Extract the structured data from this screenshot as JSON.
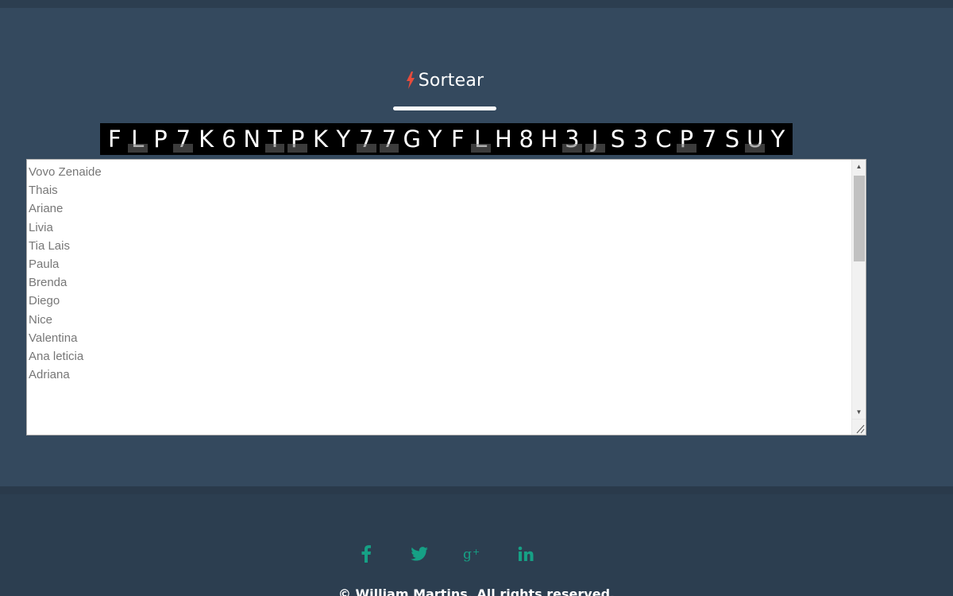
{
  "draw_button": {
    "label": "Sortear",
    "icon": "bolt-icon",
    "icon_color": "#e74c3c"
  },
  "captcha": {
    "characters": [
      "F",
      "L",
      "P",
      "7",
      "K",
      "6",
      "N",
      "T",
      "P",
      "K",
      "Y",
      "7",
      "7",
      "G",
      "Y",
      "F",
      "L",
      "H",
      "8",
      "H",
      "3",
      "J",
      "S",
      "3",
      "C",
      "P",
      "7",
      "S",
      "U",
      "Y"
    ]
  },
  "names": {
    "items": [
      "Vovo Zenaide",
      "Thais",
      "Ariane",
      "Livia",
      "Tia Lais",
      "Paula",
      "Brenda",
      "Diego",
      "Nice",
      "Valentina",
      "Ana leticia",
      "Adriana"
    ]
  },
  "footer": {
    "social": [
      "facebook-icon",
      "twitter-icon",
      "google-plus-icon",
      "linkedin-icon"
    ],
    "social_color": "#16a085",
    "copyright": "© William Martins. All rights reserved."
  },
  "colors": {
    "background": "#34495e",
    "footer": "#2c3e50"
  }
}
